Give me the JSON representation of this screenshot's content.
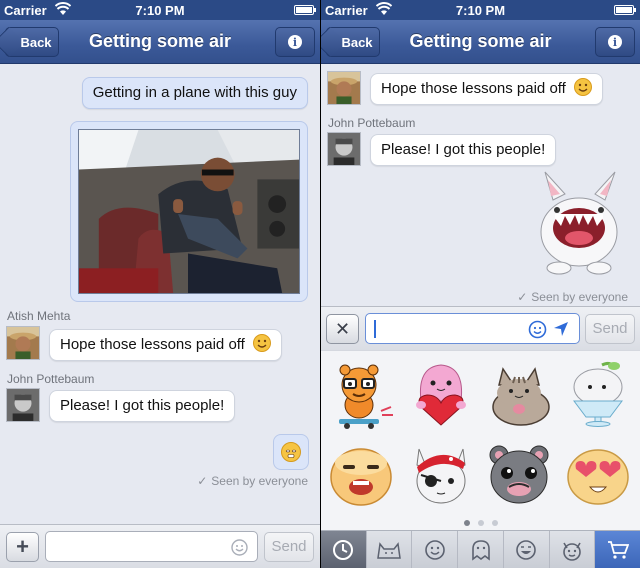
{
  "status_bar": {
    "carrier": "Carrier",
    "time": "7:10 PM"
  },
  "nav": {
    "back_label": "Back",
    "title": "Getting some air"
  },
  "left": {
    "messages": {
      "mine_text": "Getting in a plane with this guy",
      "atish_name": "Atish Mehta",
      "atish_text": "Hope those lessons paid off",
      "john_name": "John Pottebaum",
      "john_text": "Please! I got this people!",
      "seen": "Seen by everyone"
    },
    "composer": {
      "placeholder": "",
      "send_label": "Send"
    }
  },
  "right": {
    "messages": {
      "atish_text": "Hope those lessons paid off",
      "john_name": "John Pottebaum",
      "john_text": "Please! I got this people!",
      "seen": "Seen by everyone"
    },
    "composer": {
      "send_label": "Send"
    },
    "sticker_tabs": [
      "recent-icon",
      "cat-icon",
      "smiley-icon",
      "ghost-icon",
      "grin-icon",
      "devil-cat-icon",
      "store-icon"
    ],
    "stickers": [
      "tiger-skateboard",
      "pink-blob-heart",
      "pusheen-cat",
      "whale-cup",
      "egg-face",
      "pirate-cat",
      "mole-face",
      "heart-eyes-face"
    ]
  },
  "colors": {
    "nav_blue": "#3b5998",
    "mine_bubble": "#dbe5f9",
    "background": "#e6e9f1"
  }
}
